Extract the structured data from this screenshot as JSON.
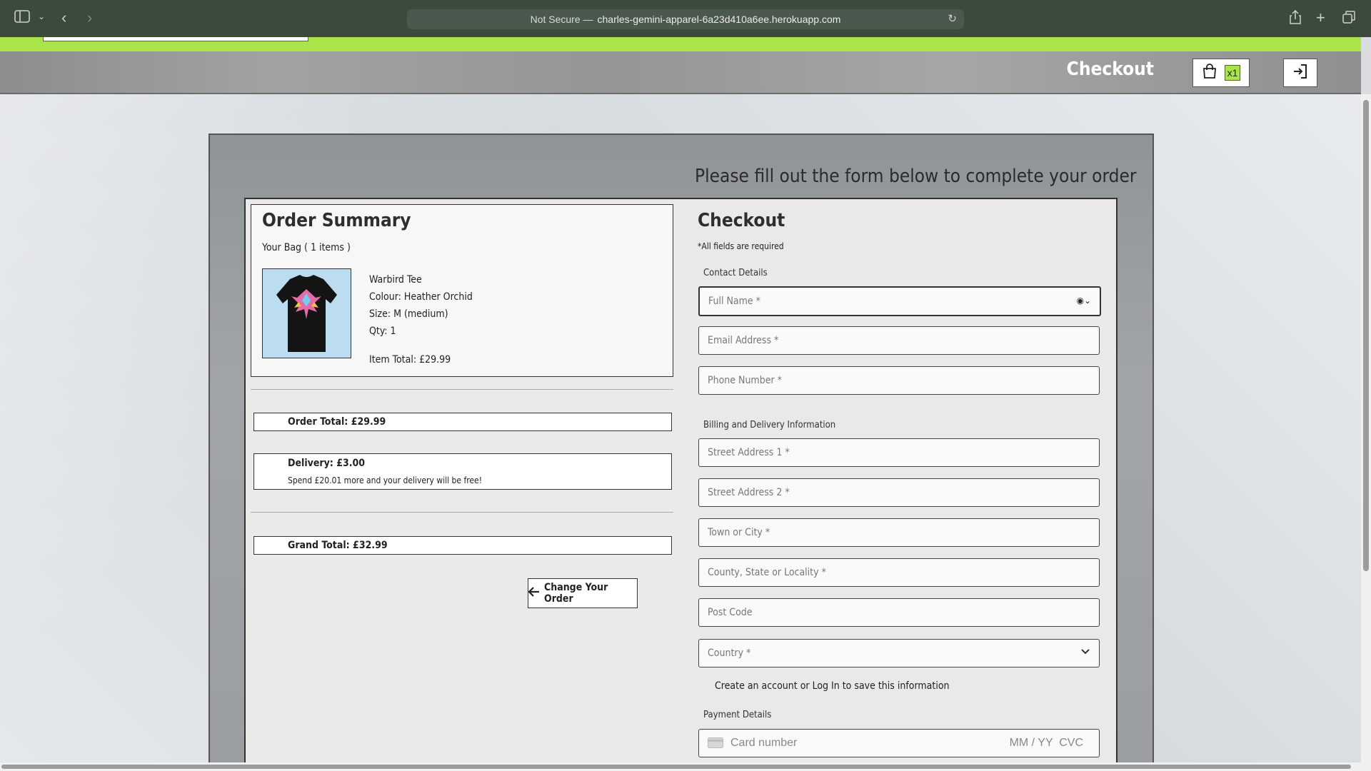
{
  "browser": {
    "not_secure": "Not Secure —",
    "url": "charles-gemini-apparel-6a23d410a6ee.herokuapp.com"
  },
  "header": {
    "page_heading": "Checkout",
    "bag_count": "x1"
  },
  "form_intro": "Please fill out the form below to complete your order",
  "summary": {
    "title": "Order Summary",
    "bag_line": "Your Bag ( 1 items )",
    "item": {
      "name": "Warbird Tee",
      "colour": "Colour: Heather Orchid",
      "size": "Size: M (medium)",
      "qty": "Qty: 1",
      "item_total": "Item Total: £29.99"
    },
    "order_total": "Order Total: £29.99",
    "delivery": "Delivery: £3.00",
    "delivery_note": "Spend £20.01 more and your delivery will be free!",
    "grand_total": "Grand Total: £32.99",
    "change_button": "Change Your Order"
  },
  "checkout": {
    "title": "Checkout",
    "required_note": "*All fields are required",
    "contact_label": "Contact Details",
    "full_name_placeholder": "Full Name *",
    "email_placeholder": "Email Address *",
    "phone_placeholder": "Phone Number *",
    "billing_label": "Billing and Delivery Information",
    "street1_placeholder": "Street Address 1 *",
    "street2_placeholder": "Street Address 2 *",
    "town_placeholder": "Town or City *",
    "county_placeholder": "County, State or Locality *",
    "postcode_placeholder": "Post Code",
    "country_placeholder": "Country *",
    "account_prompt": "Create an account or Log In to save this information",
    "payment_label": "Payment Details",
    "card_placeholder": "Card number",
    "card_expiry_cvc": "MM / YY  CVC"
  },
  "colors": {
    "accent_green": "#a8e44a",
    "browser_chrome": "#3c4a3e"
  },
  "icons": [
    "sidebar-icon",
    "chevron-down-icon",
    "back-arrow-icon",
    "forward-arrow-icon",
    "reload-icon",
    "share-icon",
    "new-tab-icon",
    "tabs-overview-icon",
    "shopping-bag-icon",
    "login-icon",
    "arrow-left-icon",
    "contact-autofill-icon",
    "card-icon"
  ]
}
